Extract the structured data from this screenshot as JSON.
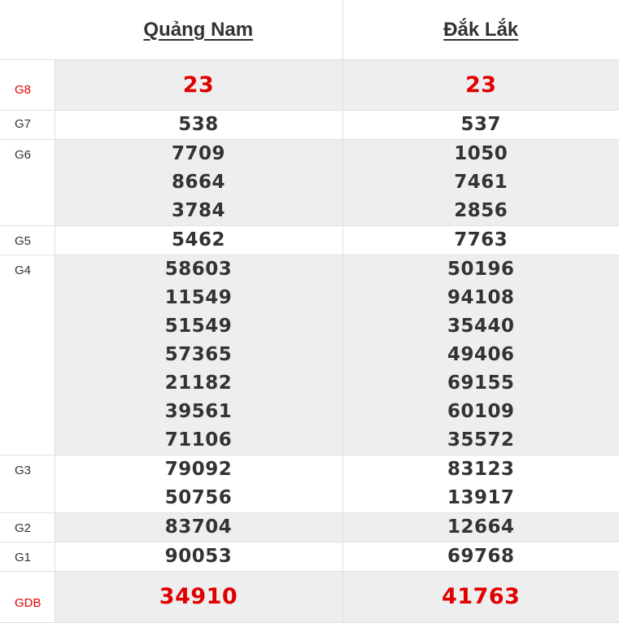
{
  "provinces": [
    "Quảng Nam",
    "Đắk Lắk"
  ],
  "prizes": {
    "g8": {
      "label": "G8",
      "p1": [
        "23"
      ],
      "p2": [
        "23"
      ]
    },
    "g7": {
      "label": "G7",
      "p1": [
        "538"
      ],
      "p2": [
        "537"
      ]
    },
    "g6": {
      "label": "G6",
      "p1": [
        "7709",
        "8664",
        "3784"
      ],
      "p2": [
        "1050",
        "7461",
        "2856"
      ]
    },
    "g5": {
      "label": "G5",
      "p1": [
        "5462"
      ],
      "p2": [
        "7763"
      ]
    },
    "g4": {
      "label": "G4",
      "p1": [
        "58603",
        "11549",
        "51549",
        "57365",
        "21182",
        "39561",
        "71106"
      ],
      "p2": [
        "50196",
        "94108",
        "35440",
        "49406",
        "69155",
        "60109",
        "35572"
      ]
    },
    "g3": {
      "label": "G3",
      "p1": [
        "79092",
        "50756"
      ],
      "p2": [
        "83123",
        "13917"
      ]
    },
    "g2": {
      "label": "G2",
      "p1": [
        "83704"
      ],
      "p2": [
        "12664"
      ]
    },
    "g1": {
      "label": "G1",
      "p1": [
        "90053"
      ],
      "p2": [
        "69768"
      ]
    },
    "gdb": {
      "label": "GDB",
      "p1": [
        "34910"
      ],
      "p2": [
        "41763"
      ]
    }
  },
  "colors": {
    "highlight": "#e00000",
    "row_gray": "#eeeeee",
    "text": "#333333"
  }
}
